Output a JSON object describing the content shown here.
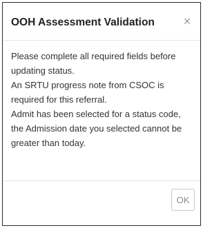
{
  "dialog": {
    "title": "OOH Assessment Validation",
    "close_glyph": "×",
    "close_icon": "close-icon",
    "message_lines": [
      "Please complete all required fields before",
      "updating status.",
      "An SRTU progress note from CSOC is",
      "required for this referral.",
      "Admit has been selected for a status code,",
      "the Admission date you selected cannot be",
      "greater than today."
    ],
    "ok_label": "OK"
  },
  "colors": {
    "border": "#2b2b2b",
    "divider": "#e5e5e5",
    "text": "#333333",
    "muted": "#8a8a8a"
  }
}
